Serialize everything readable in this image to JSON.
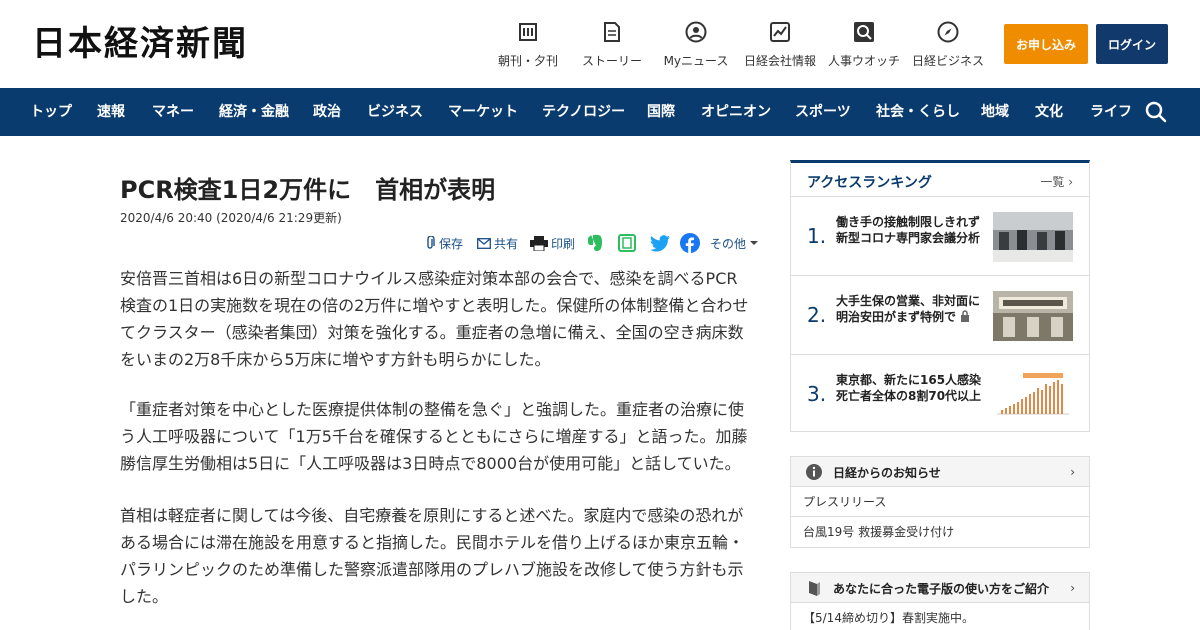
{
  "header": {
    "logo": "日本経済新聞",
    "nav": [
      {
        "label": "朝刊・夕刊",
        "icon": "newspaper-icon"
      },
      {
        "label": "ストーリー",
        "icon": "story-icon"
      },
      {
        "label": "Myニュース",
        "icon": "user-icon"
      },
      {
        "label": "日経会社情報",
        "icon": "chart-icon"
      },
      {
        "label": "人事ウオッチ",
        "icon": "search-person-icon"
      },
      {
        "label": "日経ビジネス",
        "icon": "compass-icon"
      }
    ],
    "apply_label": "お申し込み",
    "login_label": "ログイン"
  },
  "navbar": {
    "items": [
      "トップ",
      "速報",
      "マネー",
      "経済・金融",
      "政治",
      "ビジネス",
      "マーケット",
      "テクノロジー",
      "国際",
      "オピニオン",
      "スポーツ",
      "社会・くらし",
      "地域",
      "文化",
      "ライフ"
    ],
    "search_icon": "search-icon"
  },
  "article": {
    "title": "PCR検査1日2万件に　首相が表明",
    "date": "2020/4/6 20:40 (2020/4/6 21:29更新)",
    "tools": {
      "save": "保存",
      "share": "共有",
      "print": "印刷",
      "more": "その他"
    },
    "paragraphs": [
      "安倍晋三首相は6日の新型コロナウイルス感染症対策本部の会合で、感染を調べるPCR検査の1日の実施数を現在の倍の2万件に増やすと表明した。保健所の体制整備と合わせてクラスター（感染者集団）対策を強化する。重症者の急増に備え、全国の空き病床数をいまの2万8千床から5万床に増やす方針も明らかにした。",
      "「重症者対策を中心とした医療提供体制の整備を急ぐ」と強調した。重症者の治療に使う人工呼吸器について「1万5千台を確保するとともにさらに増産する」と語った。加藤勝信厚生労働相は5日に「人工呼吸器は3日時点で8000台が使用可能」と話していた。",
      "首相は軽症者に関しては今後、自宅療養を原則にすると述べた。家庭内で感染の恐れがある場合には滞在施設を用意すると指摘した。民間ホテルを借り上げるほか東京五輪・パラリンピックのため準備した警察派遣部隊用のプレハブ施設を改修して使う方針も示した。"
    ]
  },
  "sidebar": {
    "ranking": {
      "title": "アクセスランキング",
      "more": "一覧",
      "items": [
        {
          "num": "1.",
          "text": "働き手の接触制限しきれず　新型コロナ専門家会議分析"
        },
        {
          "num": "2.",
          "text": "大手生保の営業、非対面に　明治安田がまず特例で"
        },
        {
          "num": "3.",
          "text": "東京都、新たに165人感染　死亡者全体の8割70代以上"
        }
      ]
    },
    "notice": {
      "title": "日経からのお知らせ",
      "rows": [
        "プレスリリース",
        "台風19号 救援募金受け付け"
      ]
    },
    "guide": {
      "title": "あなたに合った電子版の使い方をご紹介",
      "rows": [
        "【5/14締め切り】春割実施中。"
      ]
    }
  },
  "colors": {
    "navy": "#0a3b6e",
    "orange": "#f08c00",
    "link": "#1a4f8a"
  }
}
